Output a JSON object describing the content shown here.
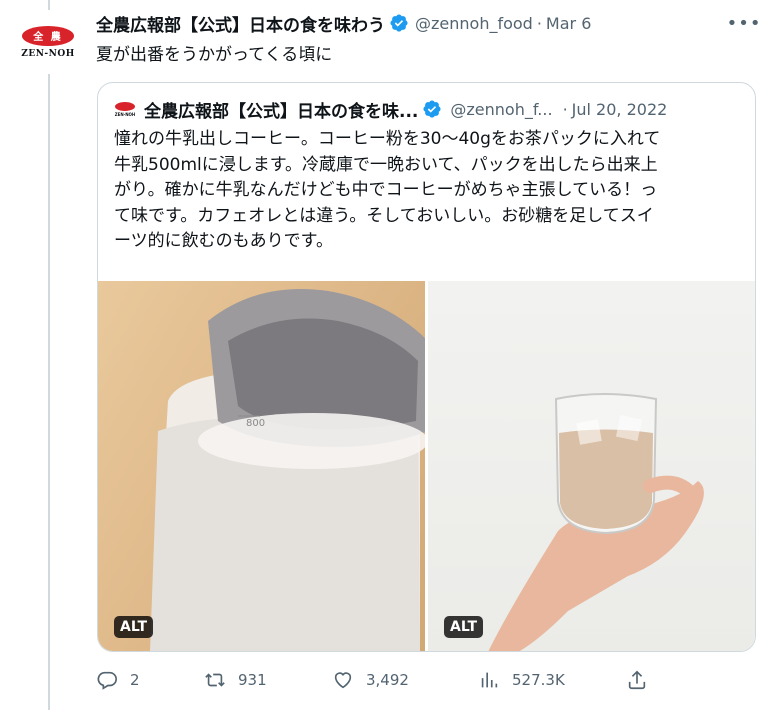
{
  "author": {
    "name": "全農広報部【公式】日本の食を味わう",
    "handle": "@zennoh_food",
    "date": "Mar 6",
    "avatar_logo": "全 農",
    "avatar_brand": "ZEN-NOH"
  },
  "tweet": {
    "text": "夏が出番をうかがってくる頃に"
  },
  "quoted": {
    "name": "全農広報部【公式】日本の食を味...",
    "handle": "@zennoh_f...",
    "date": "Jul 20, 2022",
    "text_lines": [
      "憧れの牛乳出しコーヒー。コーヒー粉を30〜40gをお茶パックに入れて",
      "牛乳500mlに浸します。冷蔵庫で一晩おいて、パックを出したら出来上",
      "がり。確かに牛乳なんだけども中でコーヒーがめちゃ主張している！っ",
      "て味です。カフェオレとは違う。そしておいしい。お砂糖を足してスイ",
      "ーツ的に飲むのもありです。"
    ],
    "photos": [
      {
        "alt_label": "ALT",
        "bottle_mark": "800"
      },
      {
        "alt_label": "ALT"
      }
    ]
  },
  "actions": {
    "replies": "2",
    "retweets": "931",
    "likes": "3,492",
    "views": "527.3K"
  },
  "icons": [
    "more-icon",
    "verified-icon",
    "reply-icon",
    "retweet-icon",
    "like-icon",
    "views-icon",
    "share-icon"
  ],
  "colors": {
    "brand_red": "#d8232a",
    "verified_blue": "#1d9bf0",
    "secondary_text": "#536471"
  }
}
